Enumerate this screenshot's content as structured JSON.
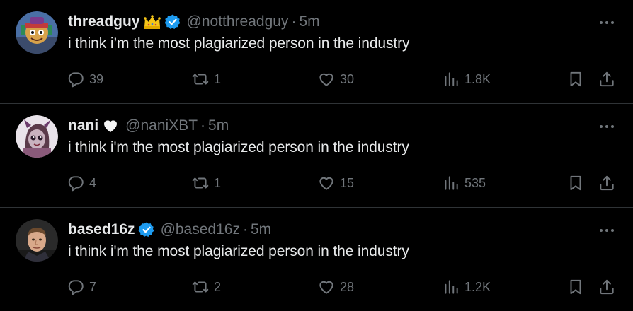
{
  "tweets": [
    {
      "name": "threadguy",
      "has_crown": true,
      "verified": true,
      "handle": "@notthreadguy",
      "dot": "·",
      "time": "5m",
      "text": "i think i’m the most plagiarized person in the industry",
      "replies": "39",
      "retweets": "1",
      "likes": "30",
      "views": "1.8K"
    },
    {
      "name": "nani",
      "has_heart": true,
      "verified": false,
      "handle": "@naniXBT",
      "dot": "·",
      "time": "5m",
      "text": "i think i'm the most plagiarized person in the industry",
      "replies": "4",
      "retweets": "1",
      "likes": "15",
      "views": "535"
    },
    {
      "name": "based16z",
      "verified": true,
      "handle": "@based16z",
      "dot": "·",
      "time": "5m",
      "text": "i think i'm the most plagiarized person in the industry",
      "replies": "7",
      "retweets": "2",
      "likes": "28",
      "views": "1.2K"
    }
  ],
  "colors": {
    "background": "#000000",
    "text": "#e7e9ea",
    "muted": "#71767b",
    "divider": "#2f3336",
    "verified_blue": "#1d9bf0"
  },
  "icons": [
    "reply-icon",
    "retweet-icon",
    "like-icon",
    "views-icon",
    "bookmark-icon",
    "share-icon",
    "more-icon",
    "verified-badge-icon",
    "crown-emoji-icon",
    "white-heart-emoji-icon"
  ]
}
